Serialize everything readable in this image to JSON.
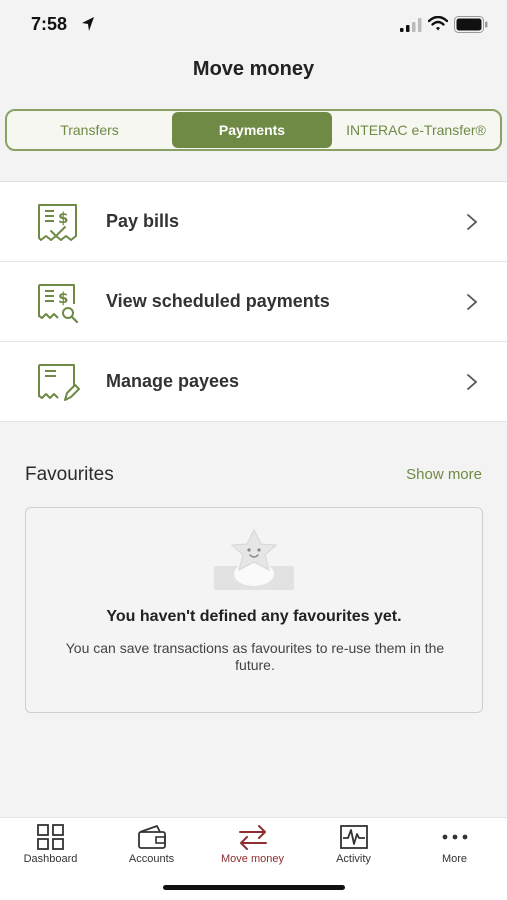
{
  "status_bar": {
    "time": "7:58"
  },
  "header": {
    "title": "Move money"
  },
  "tabs": [
    {
      "label": "Transfers",
      "active": false
    },
    {
      "label": "Payments",
      "active": true
    },
    {
      "label": "INTERAC e-Transfer®",
      "active": false
    }
  ],
  "menu": [
    {
      "label": "Pay bills",
      "icon": "bill-pay-icon"
    },
    {
      "label": "View scheduled payments",
      "icon": "scheduled-payments-icon"
    },
    {
      "label": "Manage payees",
      "icon": "manage-payees-icon"
    }
  ],
  "favourites": {
    "title": "Favourites",
    "show_more": "Show more",
    "empty_title": "You haven't defined any favourites yet.",
    "empty_text": "You can save transactions as favourites to re-use them in the future."
  },
  "tab_bar": [
    {
      "label": "Dashboard",
      "icon": "dashboard-icon",
      "active": false
    },
    {
      "label": "Accounts",
      "icon": "wallet-icon",
      "active": false
    },
    {
      "label": "Move money",
      "icon": "transfer-arrows-icon",
      "active": true
    },
    {
      "label": "Activity",
      "icon": "activity-icon",
      "active": false
    },
    {
      "label": "More",
      "icon": "more-dots-icon",
      "active": false
    }
  ],
  "colors": {
    "accent": "#6f8a45",
    "active_tab": "#8f2e2e",
    "background": "#f3f3f3"
  }
}
